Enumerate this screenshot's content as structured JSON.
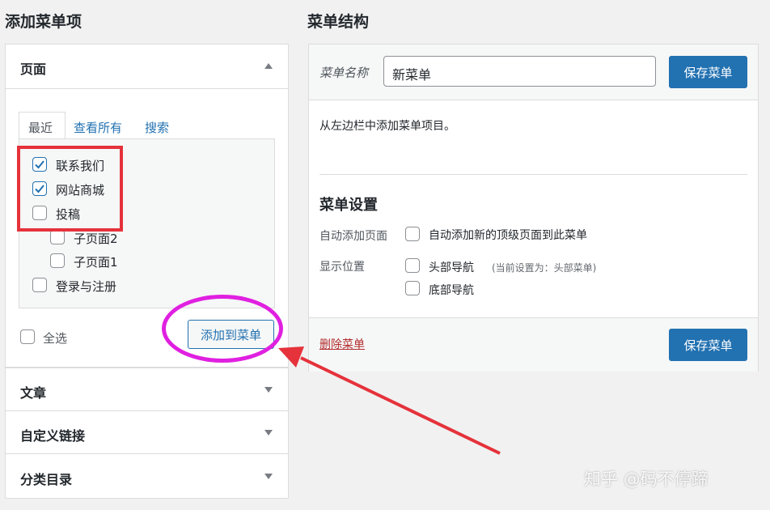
{
  "left": {
    "title": "添加菜单项",
    "pages": {
      "title": "页面",
      "tabs": [
        "最近",
        "查看所有",
        "搜索"
      ],
      "items": [
        {
          "label": "联系我们",
          "checked": true
        },
        {
          "label": "网站商城",
          "checked": true
        },
        {
          "label": "投稿",
          "checked": false
        },
        {
          "label": "子页面2",
          "checked": false
        },
        {
          "label": "子页面1",
          "checked": false
        },
        {
          "label": "登录与注册",
          "checked": false
        }
      ],
      "select_all": "全选",
      "add_button": "添加到菜单"
    },
    "sections": [
      "文章",
      "自定义链接",
      "分类目录"
    ]
  },
  "right": {
    "title": "菜单结构",
    "menu_name_label": "菜单名称",
    "menu_name_value": "新菜单",
    "save_button": "保存菜单",
    "hint": "从左边栏中添加菜单项目。",
    "settings_title": "菜单设置",
    "auto_add_label": "自动添加页面",
    "auto_add_option": "自动添加新的顶级页面到此菜单",
    "display_label": "显示位置",
    "location_header": "头部导航",
    "location_header_note": "(当前设置为：头部菜单)",
    "location_footer": "底部导航",
    "delete_link": "删除菜单"
  },
  "watermark": "知乎 @码不停蹄",
  "colors": {
    "accent": "#2271b1",
    "highlight_box": "#e5323b",
    "annotation": "#e020e0",
    "delete": "#b32d2e"
  }
}
